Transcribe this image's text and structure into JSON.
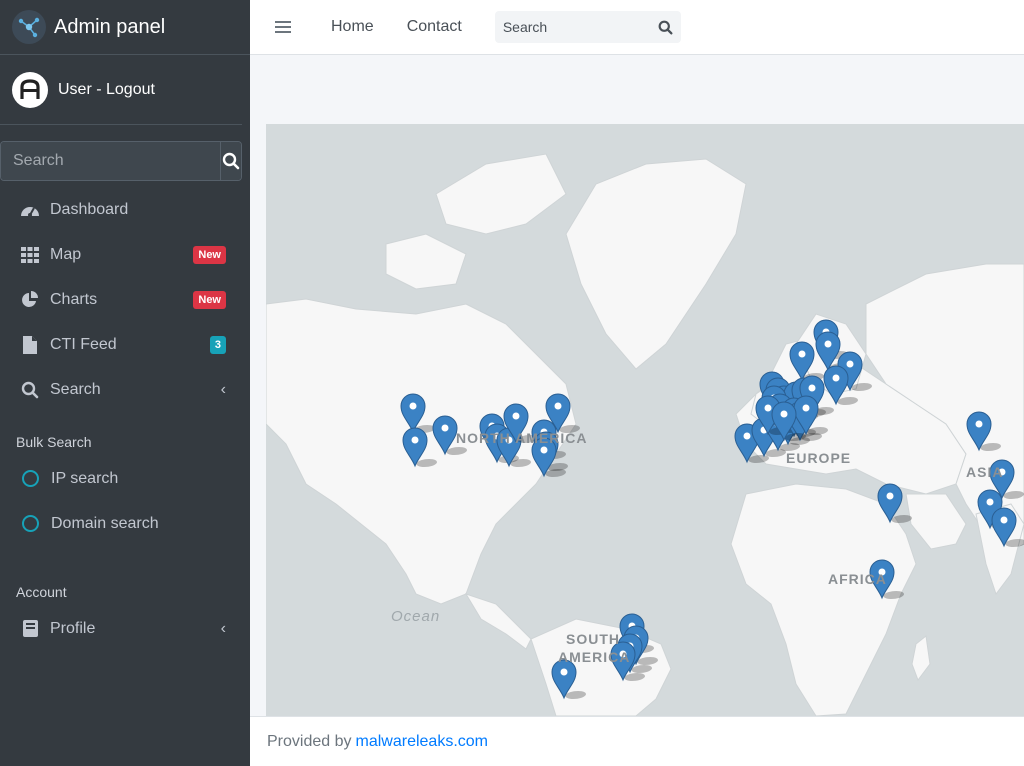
{
  "brand": {
    "title": "Admin panel",
    "logo_icon": "network-logo-icon"
  },
  "user": {
    "name": "User - Logout",
    "avatar_letter": "A"
  },
  "sidebar": {
    "search_placeholder": "Search",
    "items": [
      {
        "label": "Dashboard",
        "icon": "tachometer-icon"
      },
      {
        "label": "Map",
        "icon": "grid-icon",
        "badge": "New",
        "badge_color": "#dc3545"
      },
      {
        "label": "Charts",
        "icon": "pie-chart-icon",
        "badge": "New",
        "badge_color": "#dc3545"
      },
      {
        "label": "CTI Feed",
        "icon": "file-icon",
        "badge": "3",
        "badge_color": "#17a2b8"
      },
      {
        "label": "Search",
        "icon": "search-icon",
        "chevron": "‹"
      }
    ],
    "bulk_header": "Bulk Search",
    "bulk_items": [
      {
        "label": "IP search",
        "icon": "circle-icon"
      },
      {
        "label": "Domain search",
        "icon": "circle-icon"
      }
    ],
    "account_header": "Account",
    "account_items": [
      {
        "label": "Profile",
        "icon": "book-icon",
        "chevron": "‹"
      }
    ]
  },
  "topbar": {
    "links": [
      "Home",
      "Contact"
    ],
    "search_placeholder": "Search"
  },
  "map": {
    "labels": [
      "NORTH AMERICA",
      "EUROPE",
      "ASIA",
      "AFRICA",
      "SOUTH AMERICA"
    ],
    "ocean_label": "Ocean",
    "marker_color": "#3b82c4"
  },
  "footer": {
    "prefix": "Provided by",
    "link": "malwareleaks.com"
  },
  "colors": {
    "sidebar_bg": "#343a40",
    "accent": "#007bff",
    "badge_new": "#dc3545",
    "badge_info": "#17a2b8"
  }
}
